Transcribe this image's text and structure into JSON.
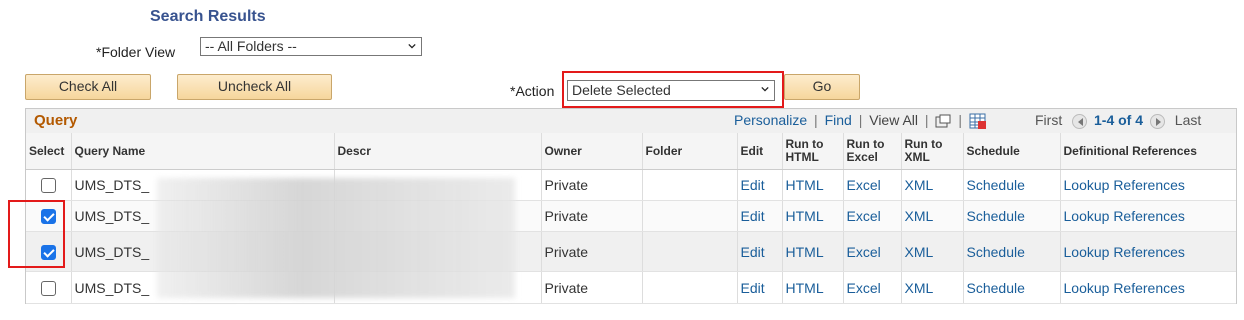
{
  "search": {
    "title": "Search Results",
    "folder_label": "*Folder View",
    "folder_value": "-- All Folders --",
    "check_all": "Check All",
    "uncheck_all": "Uncheck All",
    "action_label": "*Action",
    "action_value": "Delete Selected",
    "go": "Go"
  },
  "grid": {
    "title": "Query",
    "personalize": "Personalize",
    "find": "Find",
    "view_all": "View All",
    "first": "First",
    "range": "1-4 of 4",
    "last": "Last",
    "columns": [
      "Select",
      "Query Name",
      "Descr",
      "Owner",
      "Folder",
      "Edit",
      "Run to HTML",
      "Run to Excel",
      "Run to XML",
      "Schedule",
      "Definitional References"
    ],
    "rows": [
      {
        "checked": false,
        "name": "UMS_DTS_",
        "descr": "",
        "owner": "Private",
        "folder": "",
        "edit": "Edit",
        "html": "HTML",
        "excel": "Excel",
        "xml": "XML",
        "schedule": "Schedule",
        "refs": "Lookup References"
      },
      {
        "checked": true,
        "name": "UMS_DTS_",
        "descr": "",
        "owner": "Private",
        "folder": "",
        "edit": "Edit",
        "html": "HTML",
        "excel": "Excel",
        "xml": "XML",
        "schedule": "Schedule",
        "refs": "Lookup References"
      },
      {
        "checked": true,
        "name": "UMS_DTS_",
        "descr": "",
        "owner": "Private",
        "folder": "",
        "edit": "Edit",
        "html": "HTML",
        "excel": "Excel",
        "xml": "XML",
        "schedule": "Schedule",
        "refs": "Lookup References"
      },
      {
        "checked": false,
        "name": "UMS_DTS_",
        "descr": "",
        "owner": "Private",
        "folder": "",
        "edit": "Edit",
        "html": "HTML",
        "excel": "Excel",
        "xml": "XML",
        "schedule": "Schedule",
        "refs": "Lookup References"
      }
    ]
  },
  "colors": {
    "link": "#1a5e9a",
    "highlight": "#e31a1a",
    "title": "#b35900",
    "checkbox": "#1a73e8"
  }
}
